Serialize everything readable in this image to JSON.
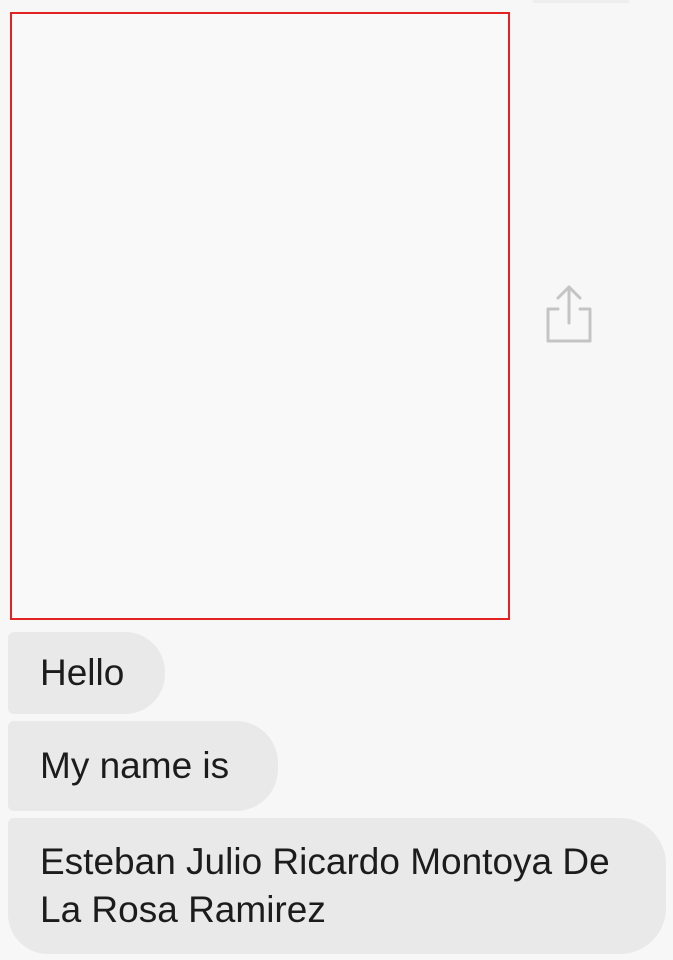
{
  "conversation": {
    "shared_media": {
      "share_icon": "share-icon",
      "border_color": "#e32222"
    },
    "messages": [
      {
        "text": "Hello"
      },
      {
        "text": "My name is"
      },
      {
        "text": "Esteban Julio Ricardo Montoya De La Rosa Ramirez"
      }
    ],
    "bubble_color": "#e9e9e9",
    "text_color": "#1c1c1c"
  }
}
